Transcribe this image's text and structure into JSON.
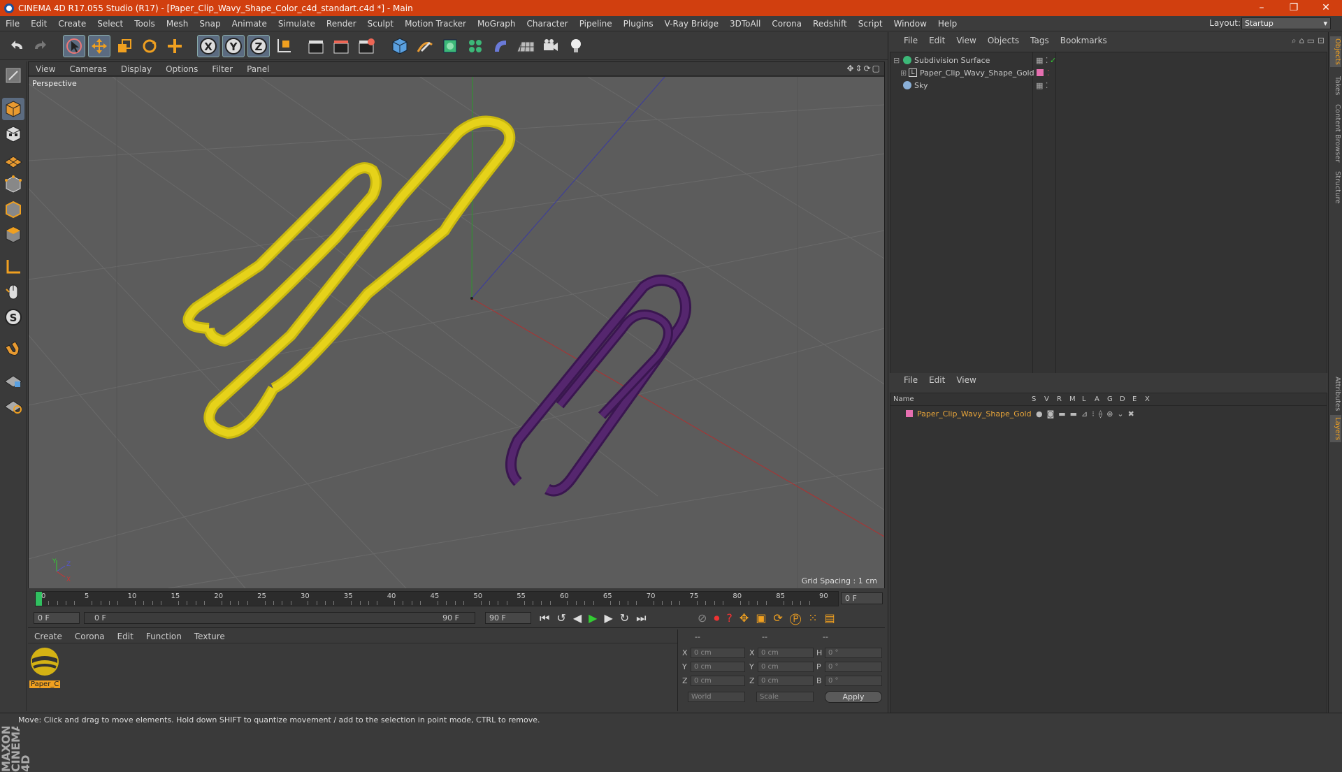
{
  "window": {
    "title": "CINEMA 4D R17.055 Studio (R17) - [Paper_Clip_Wavy_Shape_Color_c4d_standart.c4d *] - Main",
    "controls": [
      "–",
      "❐",
      "✕"
    ]
  },
  "menubar": {
    "items": [
      "File",
      "Edit",
      "Create",
      "Select",
      "Tools",
      "Mesh",
      "Snap",
      "Animate",
      "Simulate",
      "Render",
      "Sculpt",
      "Motion Tracker",
      "MoGraph",
      "Character",
      "Pipeline",
      "Plugins",
      "V-Ray Bridge",
      "3DToAll",
      "Corona",
      "Redshift",
      "Script",
      "Window",
      "Help"
    ],
    "layout_label": "Layout:",
    "layout_value": "Startup"
  },
  "viewport": {
    "menu": [
      "View",
      "Cameras",
      "Display",
      "Options",
      "Filter",
      "Panel"
    ],
    "label": "Perspective",
    "grid_spacing": "Grid Spacing : 1 cm",
    "axis_labels": {
      "y": "Y",
      "z": "Z",
      "x": "X"
    }
  },
  "timeline": {
    "ticks": [
      "0",
      "5",
      "10",
      "15",
      "20",
      "25",
      "30",
      "35",
      "40",
      "45",
      "50",
      "55",
      "60",
      "65",
      "70",
      "75",
      "80",
      "85",
      "90"
    ],
    "current_frame": "0 F"
  },
  "playbar": {
    "start": "0 F",
    "range_start": "0 F",
    "range_end": "90 F",
    "end": "90 F"
  },
  "material_panel": {
    "menu": [
      "Create",
      "Corona",
      "Edit",
      "Function",
      "Texture"
    ],
    "materials": [
      {
        "name": "Paper_C"
      }
    ]
  },
  "coordinates": {
    "header": [
      "--",
      "--",
      "--"
    ],
    "rows": [
      {
        "a": "X",
        "av": "0 cm",
        "b": "X",
        "bv": "0 cm",
        "c": "H",
        "cv": "0 °"
      },
      {
        "a": "Y",
        "av": "0 cm",
        "b": "Y",
        "bv": "0 cm",
        "c": "P",
        "cv": "0 °"
      },
      {
        "a": "Z",
        "av": "0 cm",
        "b": "Z",
        "bv": "0 cm",
        "c": "B",
        "cv": "0 °"
      }
    ],
    "mode": "World",
    "transform": "Scale",
    "apply": "Apply"
  },
  "objects_panel": {
    "menu": [
      "File",
      "Edit",
      "View",
      "Objects",
      "Tags",
      "Bookmarks"
    ],
    "objects": [
      {
        "name": "Subdivision Surface",
        "level": 0
      },
      {
        "name": "Paper_Clip_Wavy_Shape_Gold",
        "level": 1
      },
      {
        "name": "Sky",
        "level": 0
      }
    ]
  },
  "layers_panel": {
    "menu": [
      "File",
      "Edit",
      "View"
    ],
    "columns": [
      "Name",
      "S",
      "V",
      "R",
      "M",
      "L",
      "A",
      "G",
      "D",
      "E",
      "X"
    ],
    "layers": [
      {
        "name": "Paper_Clip_Wavy_Shape_Gold"
      }
    ]
  },
  "side_tabs": [
    "Objects",
    "Takes",
    "Content Browser",
    "Structure",
    "Attributes",
    "Layers"
  ],
  "brand": "MAXON CINEMA 4D",
  "status": "Move: Click and drag to move elements. Hold down SHIFT to quantize movement / add to the selection in point mode, CTRL to remove.",
  "colors": {
    "title_bar": "#d13f0f",
    "gold": "#e6d21a",
    "purple": "#4a2160",
    "layer_text": "#e8a53a"
  }
}
